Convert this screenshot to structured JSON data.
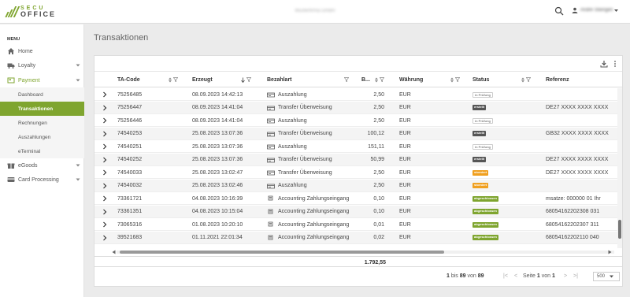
{
  "app": {
    "logo_line1": "SECU",
    "logo_line2": "OFFICE",
    "company": "Musterfirma GmbH",
    "user_name": "André Steingen"
  },
  "sidebar": {
    "menu_title": "MENU",
    "items": [
      {
        "label": "Home",
        "icon": "home-icon"
      },
      {
        "label": "Loyalty",
        "icon": "truck-icon"
      },
      {
        "label": "Payment",
        "icon": "payment-icon"
      }
    ],
    "payment_sub": [
      "Dashboard",
      "Transaktionen",
      "Rechnungen",
      "Auszahlungen",
      "eTerminal"
    ],
    "selected_sub": "Transaktionen",
    "items_after": [
      {
        "label": "eGoods",
        "icon": "gift-icon"
      },
      {
        "label": "Card Processing",
        "icon": "card-icon"
      }
    ]
  },
  "page": {
    "title": "Transaktionen"
  },
  "table": {
    "headers": {
      "ta_code": "TA-Code",
      "erzeugt": "Erzeugt",
      "bezahlart": "Bezahlart",
      "betrag": "B...",
      "waehrung": "Währung",
      "status": "Status",
      "referenz": "Referenz"
    },
    "rows": [
      {
        "ta": "75256485",
        "date": "08.09.2023 14:42:13",
        "type": "Auszahlung",
        "amount": "2,50",
        "cur": "EUR",
        "status": "in Prüfung",
        "status_kind": "pruefung",
        "ref": ""
      },
      {
        "ta": "75256447",
        "date": "08.09.2023 14:41:04",
        "type": "Transfer Überweisung",
        "amount": "2,50",
        "cur": "EUR",
        "status": "erstellt",
        "status_kind": "erstellt",
        "ref": "DE27 XXXX XXXX XXXX"
      },
      {
        "ta": "75256446",
        "date": "08.09.2023 14:41:04",
        "type": "Auszahlung",
        "amount": "2,50",
        "cur": "EUR",
        "status": "in Prüfung",
        "status_kind": "pruefung",
        "ref": ""
      },
      {
        "ta": "74540253",
        "date": "25.08.2023 13:07:36",
        "type": "Transfer Überweisung",
        "amount": "100,12",
        "cur": "EUR",
        "status": "erstellt",
        "status_kind": "erstellt",
        "ref": "GB32 XXXX XXXX XXXX"
      },
      {
        "ta": "74540251",
        "date": "25.08.2023 13:07:36",
        "type": "Auszahlung",
        "amount": "151,11",
        "cur": "EUR",
        "status": "in Prüfung",
        "status_kind": "pruefung",
        "ref": ""
      },
      {
        "ta": "74540252",
        "date": "25.08.2023 13:07:36",
        "type": "Transfer Überweisung",
        "amount": "50,99",
        "cur": "EUR",
        "status": "erstellt",
        "status_kind": "erstellt",
        "ref": "DE27 XXXX XXXX XXXX"
      },
      {
        "ta": "74540033",
        "date": "25.08.2023 13:02:47",
        "type": "Transfer Überweisung",
        "amount": "2,50",
        "cur": "EUR",
        "status": "storniert",
        "status_kind": "storniert",
        "ref": "DE27 XXXX XXXX XXXX"
      },
      {
        "ta": "74540032",
        "date": "25.08.2023 13:02:46",
        "type": "Auszahlung",
        "amount": "2,50",
        "cur": "EUR",
        "status": "storniert",
        "status_kind": "storniert",
        "ref": ""
      },
      {
        "ta": "73361721",
        "date": "04.08.2023 10:16:39",
        "type": "Accounting Zahlungseingang",
        "amount": "0,10",
        "cur": "EUR",
        "status": "abgeschlossen",
        "status_kind": "abgeschlossen",
        "ref": "msatze: 000000 01 Ihr"
      },
      {
        "ta": "73361351",
        "date": "04.08.2023 10:15:04",
        "type": "Accounting Zahlungseingang",
        "amount": "0,10",
        "cur": "EUR",
        "status": "abgeschlossen",
        "status_kind": "abgeschlossen",
        "ref": "68054162202308 031"
      },
      {
        "ta": "73065316",
        "date": "01.08.2023 10:20:10",
        "type": "Accounting Zahlungseingang",
        "amount": "0,01",
        "cur": "EUR",
        "status": "abgeschlossen",
        "status_kind": "abgeschlossen",
        "ref": "68054162202307 311"
      },
      {
        "ta": "39521683",
        "date": "01.11.2021 22:01:34",
        "type": "Accounting Zahlungseingang",
        "amount": "0,02",
        "cur": "EUR",
        "status": "abgeschlossen",
        "status_kind": "abgeschlossen",
        "ref": "68054162202110 040"
      }
    ],
    "sum": "1.792,55"
  },
  "pager": {
    "from": "1",
    "bis_label": "bis",
    "to": "89",
    "von_label": "von",
    "total": "89",
    "seite_label": "Seite",
    "page": "1",
    "von2_label": "von",
    "pages": "1",
    "page_size": "500"
  },
  "colors": {
    "accent": "#7fa52f",
    "erstellt": "#555555",
    "storniert": "#f0a020",
    "abgeschlossen": "#7fa52f"
  }
}
